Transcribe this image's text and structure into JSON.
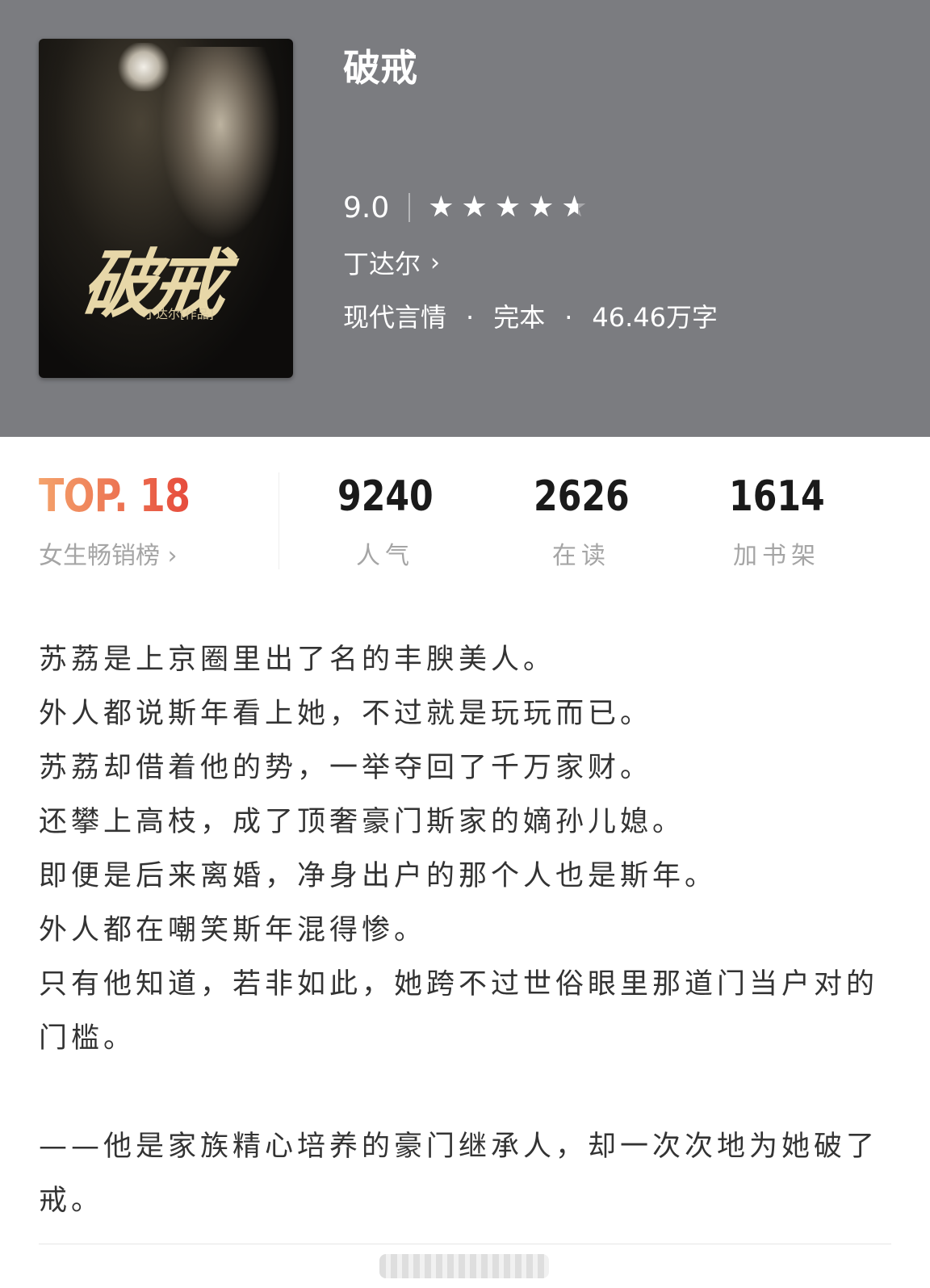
{
  "book": {
    "title": "破戒",
    "cover_title": "破戒",
    "cover_author": "丁达尔[作品]",
    "score": "9.0",
    "stars_rating": 4.5,
    "stars_max": 5,
    "author": "丁达尔",
    "genre": "现代言情",
    "status": "完本",
    "word_count": "46.46万字",
    "separator": "·"
  },
  "stats": {
    "rank": "TOP. 18",
    "rank_list": "女生畅销榜",
    "items": [
      {
        "value": "9240",
        "label": "人气"
      },
      {
        "value": "2626",
        "label": "在读"
      },
      {
        "value": "1614",
        "label": "加书架"
      }
    ]
  },
  "icons": {
    "chevron": "chevron-right-icon",
    "star": "star-icon"
  },
  "synopsis": {
    "lines": [
      "苏荔是上京圈里出了名的丰腴美人。",
      "外人都说斯年看上她，不过就是玩玩而已。",
      "苏荔却借着他的势，一举夺回了千万家财。",
      "还攀上高枝，成了顶奢豪门斯家的嫡孙儿媳。",
      "即便是后来离婚，净身出户的那个人也是斯年。",
      "外人都在嘲笑斯年混得惨。",
      "只有他知道，若非如此，她跨不过世俗眼里那道门当户对的门槛。"
    ],
    "tagline": "——他是家族精心培养的豪门继承人，却一次次地为她破了戒。"
  },
  "colors": {
    "header_bg": "#7b7c80",
    "rank_gradient_start": "#f4a36c",
    "rank_gradient_end": "#e64b3c",
    "stat_label": "#a5a5a5"
  }
}
